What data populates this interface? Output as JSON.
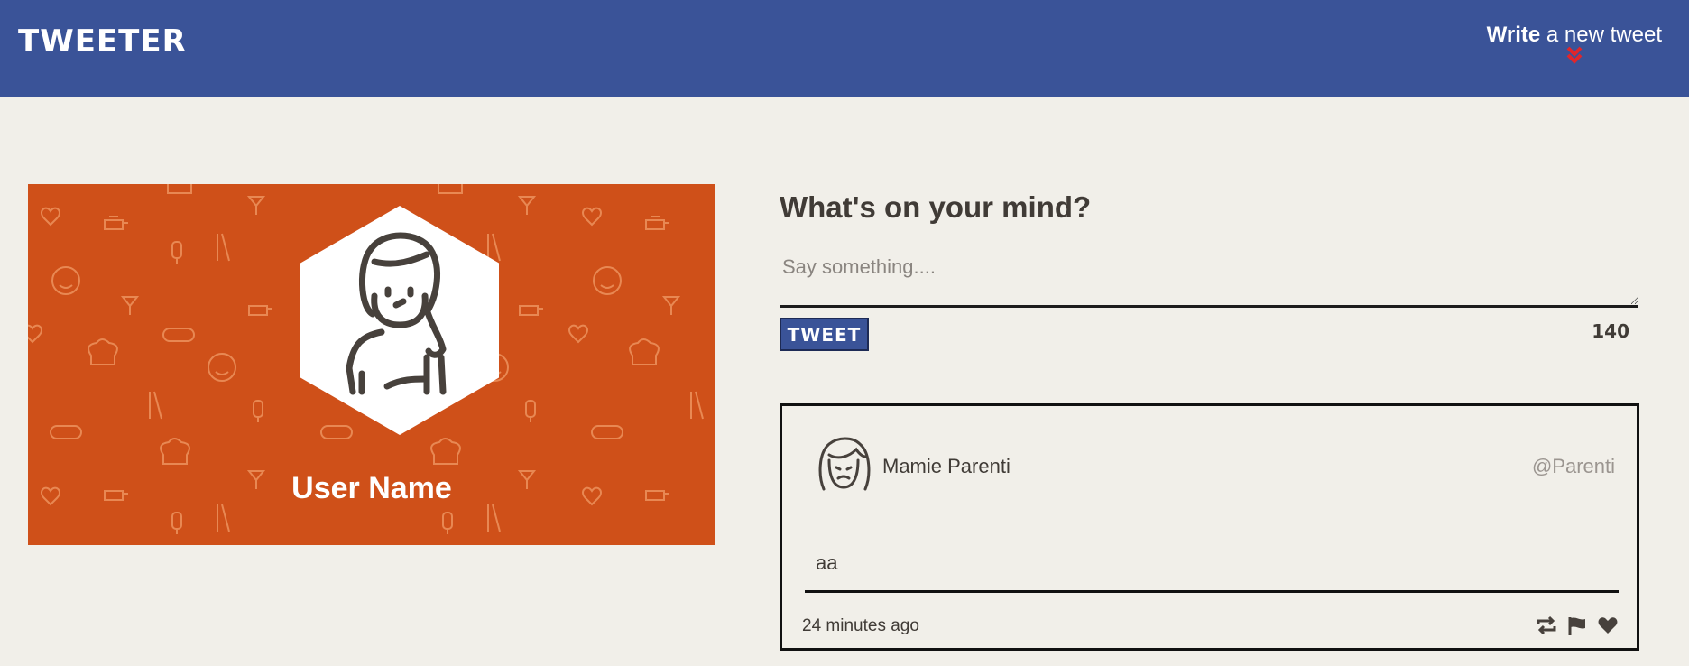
{
  "navbar": {
    "brand": "TWEETER",
    "write_bold": "Write",
    "write_rest": " a new tweet",
    "bg_color": "#3a5398",
    "chevron_color": "#e0262b"
  },
  "profile": {
    "username": "User Name",
    "banner_color": "#cf5019"
  },
  "compose": {
    "title": "What's on your mind?",
    "placeholder": "Say something....",
    "button_label": "TWEET",
    "counter": "140"
  },
  "tweets": [
    {
      "name": "Mamie Parenti",
      "handle": "@Parenti",
      "text": "aa",
      "time": "24 minutes ago",
      "actions": [
        "retweet-icon",
        "flag-icon",
        "heart-icon"
      ]
    }
  ]
}
